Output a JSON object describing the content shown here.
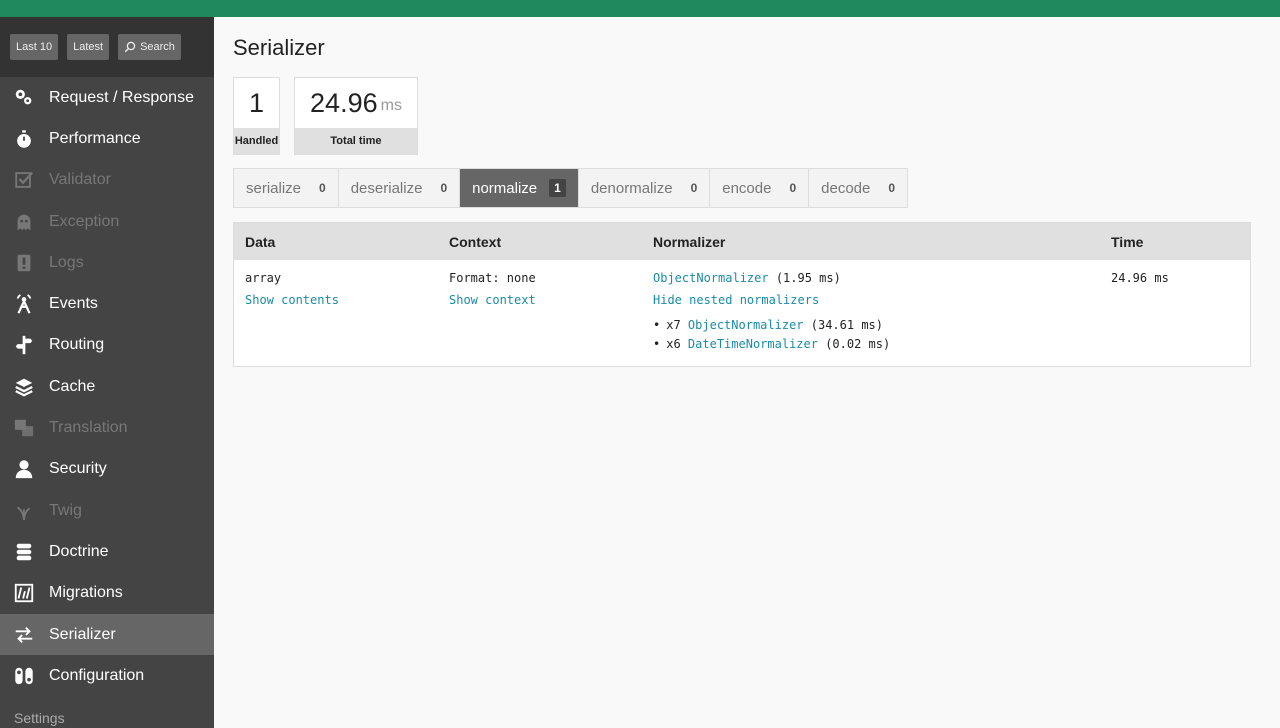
{
  "toolbar": {
    "last10": "Last 10",
    "latest": "Latest",
    "search": "Search"
  },
  "menu": [
    {
      "label": "Request / Response",
      "icon": "gears-icon",
      "state": "normal"
    },
    {
      "label": "Performance",
      "icon": "stopwatch-icon",
      "state": "normal"
    },
    {
      "label": "Validator",
      "icon": "checkbox-icon",
      "state": "disabled"
    },
    {
      "label": "Exception",
      "icon": "ghost-icon",
      "state": "disabled"
    },
    {
      "label": "Logs",
      "icon": "logs-icon",
      "state": "disabled"
    },
    {
      "label": "Events",
      "icon": "events-icon",
      "state": "normal"
    },
    {
      "label": "Routing",
      "icon": "signpost-icon",
      "state": "normal"
    },
    {
      "label": "Cache",
      "icon": "layers-icon",
      "state": "normal"
    },
    {
      "label": "Translation",
      "icon": "translation-icon",
      "state": "disabled"
    },
    {
      "label": "Security",
      "icon": "user-icon",
      "state": "normal"
    },
    {
      "label": "Twig",
      "icon": "twig-icon",
      "state": "disabled"
    },
    {
      "label": "Doctrine",
      "icon": "database-icon",
      "state": "normal"
    },
    {
      "label": "Migrations",
      "icon": "migrations-icon",
      "state": "normal"
    },
    {
      "label": "Serializer",
      "icon": "arrows-icon",
      "state": "selected"
    },
    {
      "label": "Configuration",
      "icon": "toggle-icon",
      "state": "normal"
    }
  ],
  "settings_label": "Settings",
  "page_title": "Serializer",
  "metrics": [
    {
      "value": "1",
      "unit": "",
      "label": "Handled"
    },
    {
      "value": "24.96",
      "unit": "ms",
      "label": "Total time"
    }
  ],
  "tabs": [
    {
      "label": "serialize",
      "count": "0",
      "active": false
    },
    {
      "label": "deserialize",
      "count": "0",
      "active": false
    },
    {
      "label": "normalize",
      "count": "1",
      "active": true
    },
    {
      "label": "denormalize",
      "count": "0",
      "active": false
    },
    {
      "label": "encode",
      "count": "0",
      "active": false
    },
    {
      "label": "decode",
      "count": "0",
      "active": false
    }
  ],
  "table": {
    "headers": [
      "Data",
      "Context",
      "Normalizer",
      "Time"
    ],
    "row": {
      "data": "array",
      "data_link": "Show contents",
      "context": "Format: none",
      "context_link": "Show context",
      "normalizer": "ObjectNormalizer",
      "normalizer_time": " (1.95 ms)",
      "nested_link": "Hide nested normalizers",
      "nested": [
        {
          "count": "x7 ",
          "name": "ObjectNormalizer",
          "time": " (34.61 ms)"
        },
        {
          "count": "x6 ",
          "name": "DateTimeNormalizer",
          "time": " (0.02 ms)"
        }
      ],
      "time": "24.96 ms"
    }
  },
  "colors": {
    "topbar": "#1e8a5e",
    "sidebar": "#444444",
    "link": "#1a8ca7",
    "active_tab": "#666666"
  }
}
